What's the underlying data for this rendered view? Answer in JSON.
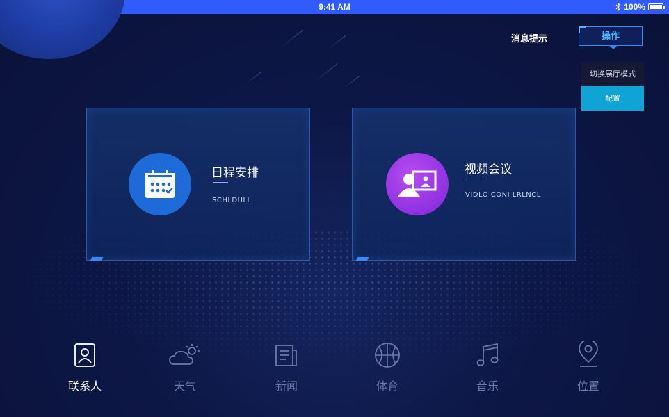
{
  "status_bar": {
    "time": "9:41 AM",
    "battery": "100%"
  },
  "header": {
    "message_tip": "消息提示",
    "operate_button": "操作"
  },
  "dropdown": {
    "items": [
      "切换展厅模式",
      "配置"
    ]
  },
  "cards": [
    {
      "title": "日程安排",
      "subtitle": "SCHLDULL",
      "icon": "calendar-icon",
      "color": "#1e6ad8"
    },
    {
      "title": "视频会议",
      "subtitle": "VIDLO CONI LRLNCL",
      "icon": "video-conference-icon",
      "color": "#8b2fe0"
    }
  ],
  "nav": [
    {
      "label": "联系人",
      "icon": "contact-icon",
      "active": true
    },
    {
      "label": "天气",
      "icon": "weather-icon",
      "active": false
    },
    {
      "label": "新闻",
      "icon": "news-icon",
      "active": false
    },
    {
      "label": "体育",
      "icon": "basketball-icon",
      "active": false
    },
    {
      "label": "音乐",
      "icon": "music-icon",
      "active": false
    },
    {
      "label": "位置",
      "icon": "location-icon",
      "active": false
    }
  ],
  "colors": {
    "status_bar": "#2f5bff",
    "accent": "#4db6ff",
    "dropdown_active": "#0ea4d6",
    "background": "#0d1746"
  }
}
